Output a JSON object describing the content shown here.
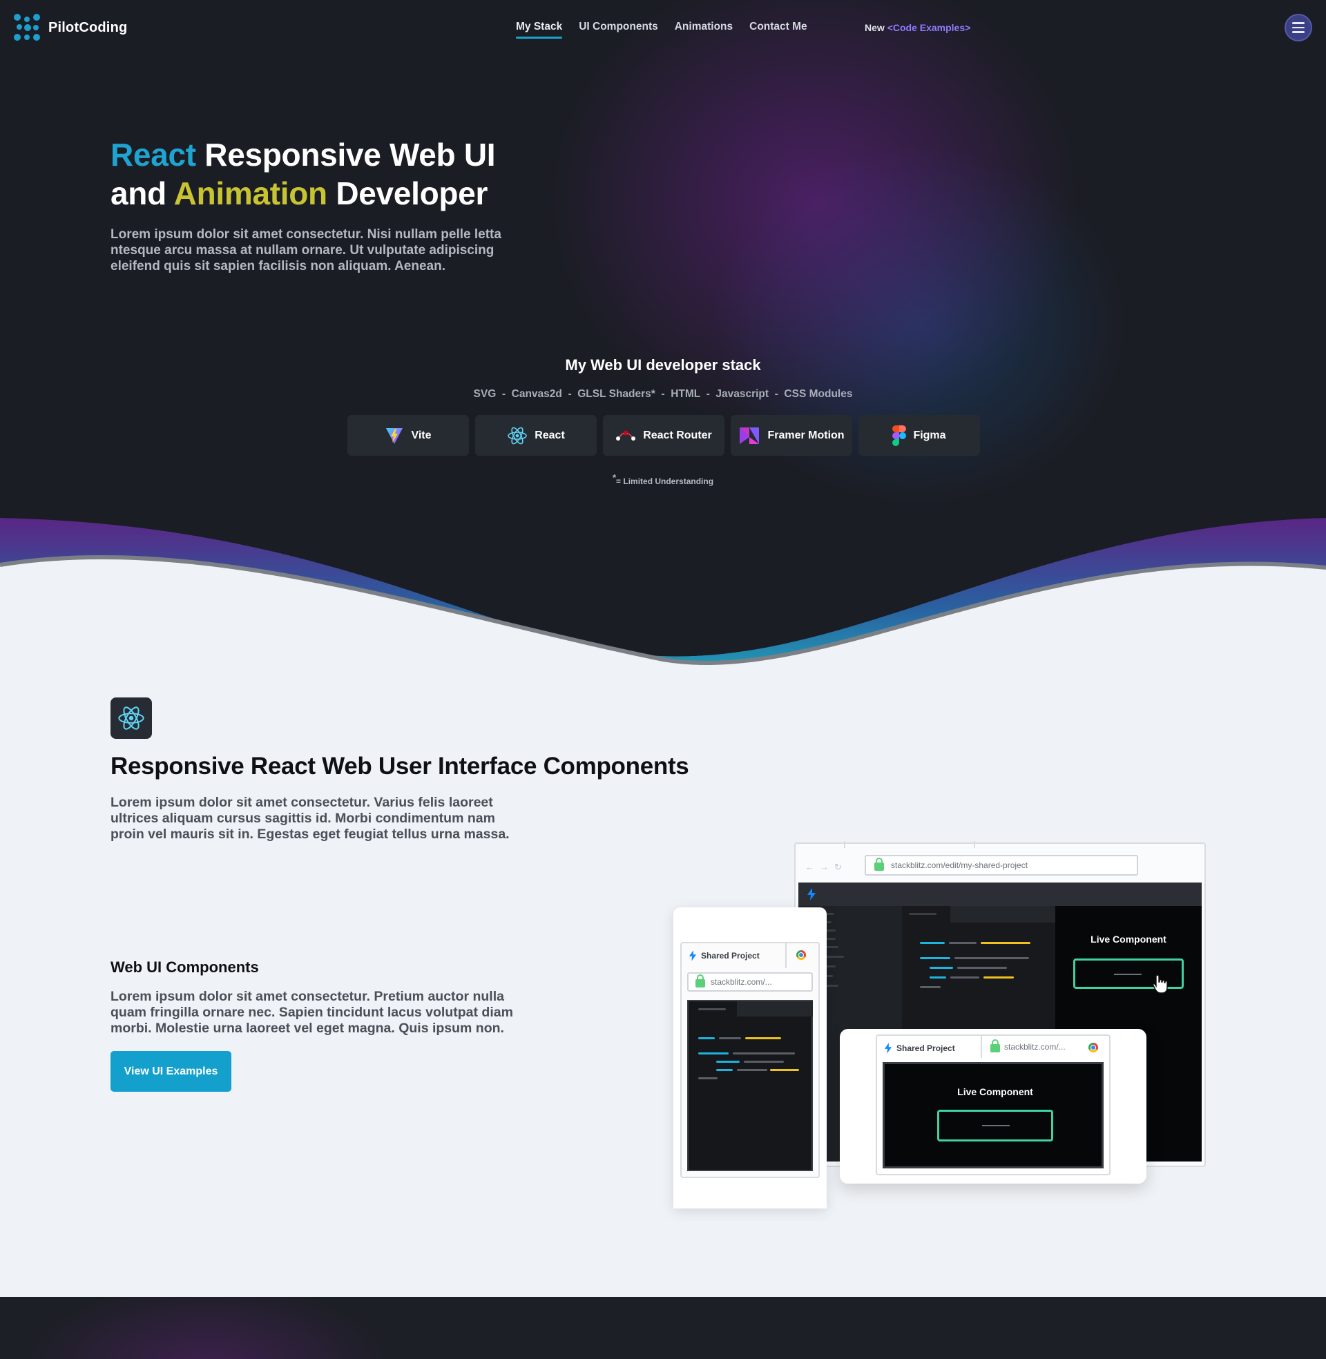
{
  "brand": {
    "name": "PilotCoding"
  },
  "nav": {
    "links": [
      "My Stack",
      "UI Components",
      "Animations",
      "Contact Me"
    ],
    "active": "My Stack",
    "new_label": "New",
    "new_link": "<Code Examples>",
    "menu_icon": "hamburger-icon"
  },
  "hero": {
    "title_word_react": "React",
    "title_part1": " Responsive Web UI",
    "title_part2": "and ",
    "title_word_animation": "Animation",
    "title_part3": " Developer",
    "subtitle": "Lorem ipsum dolor sit amet consectetur. Nisi nullam pelle letta ntesque arcu massa at nullam ornare. Ut vulputate adipiscing eleifend quis sit sapien facilisis non aliquam. Aenean.",
    "accent_react": "#1fa3d0",
    "accent_animation": "#c8c431"
  },
  "stack": {
    "title": "My Web UI developer stack",
    "line": "SVG  -  Canvas2d  -  GLSL Shaders*  -  HTML  -  Javascript  -  CSS Modules",
    "buttons": [
      {
        "label": "Vite",
        "icon": "vite-icon"
      },
      {
        "label": "React",
        "icon": "react-icon"
      },
      {
        "label": "React Router",
        "icon": "react-router-icon"
      },
      {
        "label": "Framer Motion",
        "icon": "framer-motion-icon"
      },
      {
        "label": "Figma",
        "icon": "figma-icon"
      }
    ],
    "note_star": "*",
    "note": "= Limited Understanding"
  },
  "components_section": {
    "icon": "react-icon",
    "title": "Responsive React Web User Interface Components",
    "text": "Lorem ipsum dolor sit amet consectetur. Varius felis laoreet ultrices aliquam cursus sagittis id. Morbi condimentum nam proin vel mauris sit in. Egestas eget feugiat tellus urna massa.",
    "subtitle": "Web UI Components",
    "subtext": "Lorem ipsum dolor sit amet consectetur. Pretium auctor nulla quam fringilla ornare nec. Sapien tincidunt lacus volutpat diam morbi. Molestie urna laoreet vel eget magna. Quis ipsum non.",
    "cta": "View UI Examples",
    "cta_color": "#13a0cc"
  },
  "illustration": {
    "desktop_url": "stackblitz.com/edit/my-shared-project",
    "live_component": "Live Component",
    "shared_project": "Shared Project",
    "short_url": "stackblitz.com/..."
  }
}
